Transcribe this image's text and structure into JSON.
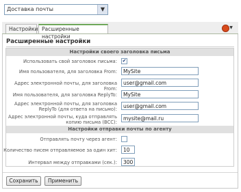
{
  "module_select": {
    "value": "Доставка почты"
  },
  "tabs": [
    {
      "label": "Настройки"
    },
    {
      "label": "Расширенные настройки"
    }
  ],
  "icons": {
    "help": "help-icon"
  },
  "section_title": "Расширенные настройки",
  "sender_header": {
    "title": "Настройки своего заголовка письма",
    "use_own_header_label": "Использовать свой заголовок письма:",
    "use_own_header_checked": true,
    "from_name_label": "Имя пользователя, для заголовка From:",
    "from_name_value": "MySite",
    "from_email_label": "Адрес электронной почты, для заголовка From:",
    "from_email_value": "user@gmail.com",
    "replyto_name_label": "Имя пользователя, для заголовка ReplyTo:",
    "replyto_name_value": "MySite",
    "replyto_email_label_1": "Адрес электронной почты, для заголовка",
    "replyto_email_label_2": "ReplyTo (для ответа на письмо):",
    "replyto_email_value": "user@gmail.com",
    "bcc_label_1": "Адрес электронной почты, куда отправлять",
    "bcc_label_2": "копию письма (BCC):",
    "bcc_value": "mysite@mail.ru"
  },
  "agent": {
    "title": "Настройки отправки почты по агенту",
    "send_via_agent_label": "Отправлять почту через агент:",
    "send_via_agent_checked": false,
    "per_hit_label": "Количество писем отправляемое за один хит:",
    "per_hit_value": "10",
    "interval_label": "Интервал между отправками (сек.):",
    "interval_value": "300"
  },
  "buttons": {
    "save": "Сохранить",
    "apply": "Применить"
  }
}
